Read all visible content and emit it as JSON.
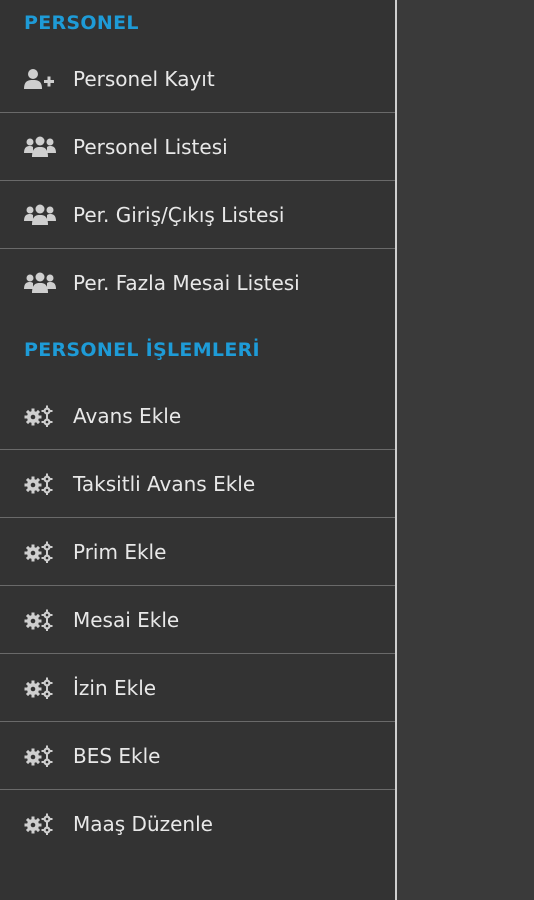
{
  "sidebar": {
    "sections": [
      {
        "title": "PERSONEL",
        "items": [
          {
            "label": "Personel Kayıt",
            "icon": "user-plus-icon"
          },
          {
            "label": "Personel Listesi",
            "icon": "users-icon"
          },
          {
            "label": "Per. Giriş/Çıkış Listesi",
            "icon": "users-icon"
          },
          {
            "label": "Per. Fazla Mesai Listesi",
            "icon": "users-icon"
          }
        ]
      },
      {
        "title": "PERSONEL İŞLEMLERİ",
        "items": [
          {
            "label": "Avans Ekle",
            "icon": "gears-icon"
          },
          {
            "label": "Taksitli Avans Ekle",
            "icon": "gears-icon"
          },
          {
            "label": "Prim Ekle",
            "icon": "gears-icon"
          },
          {
            "label": "Mesai Ekle",
            "icon": "gears-icon"
          },
          {
            "label": "İzin Ekle",
            "icon": "gears-icon"
          },
          {
            "label": "BES Ekle",
            "icon": "gears-icon"
          },
          {
            "label": "Maaş Düzenle",
            "icon": "gears-icon"
          }
        ]
      }
    ]
  },
  "colors": {
    "section_title": "#1e9bd7",
    "item_text": "#e8e8e8",
    "icon": "#cfcfcf",
    "sidebar_bg": "#333333"
  }
}
